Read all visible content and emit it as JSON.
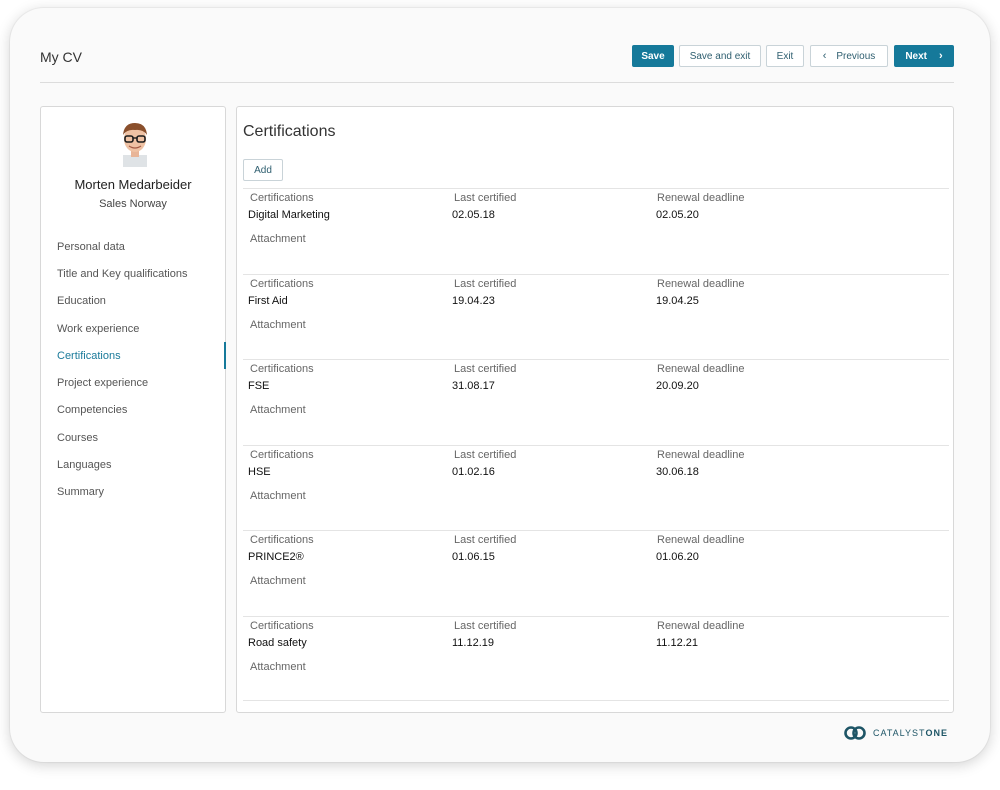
{
  "header": {
    "title": "My CV",
    "save_label": "Save",
    "save_exit_label": "Save and exit",
    "exit_label": "Exit",
    "previous_label": "Previous",
    "next_label": "Next"
  },
  "profile": {
    "name": "Morten Medarbeider",
    "role": "Sales Norway"
  },
  "sidebar": {
    "items": [
      {
        "label": "Personal data"
      },
      {
        "label": "Title and Key qualifications"
      },
      {
        "label": "Education"
      },
      {
        "label": "Work experience"
      },
      {
        "label": "Certifications"
      },
      {
        "label": "Project experience"
      },
      {
        "label": "Competencies"
      },
      {
        "label": "Courses"
      },
      {
        "label": "Languages"
      },
      {
        "label": "Summary"
      }
    ],
    "active": "Certifications"
  },
  "main": {
    "title": "Certifications",
    "add_label": "Add",
    "columns": {
      "certification": "Certifications",
      "last_certified": "Last certified",
      "renewal_deadline": "Renewal deadline",
      "attachment": "Attachment"
    },
    "rows": [
      {
        "name": "Digital Marketing",
        "last_certified": "02.05.18",
        "renewal_deadline": "02.05.20"
      },
      {
        "name": "First Aid",
        "last_certified": "19.04.23",
        "renewal_deadline": "19.04.25"
      },
      {
        "name": "FSE",
        "last_certified": "31.08.17",
        "renewal_deadline": "20.09.20"
      },
      {
        "name": "HSE",
        "last_certified": "01.02.16",
        "renewal_deadline": "30.06.18"
      },
      {
        "name": "PRINCE2®",
        "last_certified": "01.06.15",
        "renewal_deadline": "01.06.20"
      },
      {
        "name": "Road safety",
        "last_certified": "11.12.19",
        "renewal_deadline": "11.12.21"
      }
    ]
  },
  "brand": {
    "logo_part1": "CATALYST",
    "logo_part2": "ONE",
    "accent_color": "#15799a"
  }
}
